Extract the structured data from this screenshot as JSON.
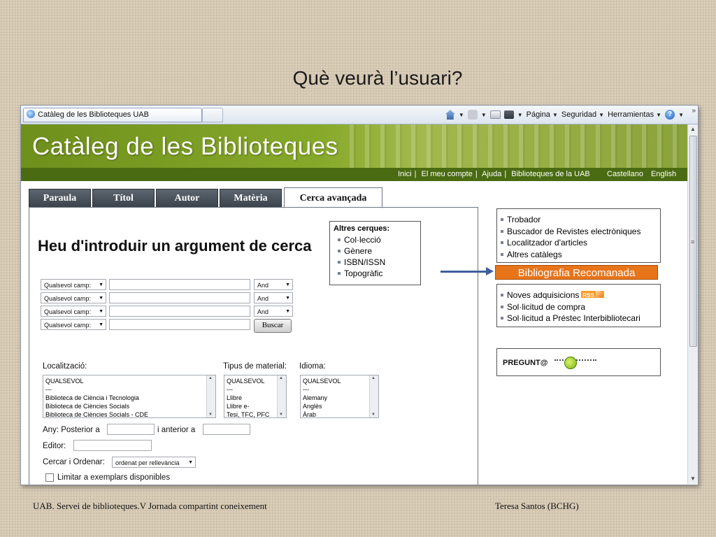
{
  "slide": {
    "title": "Què veurà l’usuari?",
    "footer_left": "UAB. Servei de biblioteques.V Jornada compartint coneixement",
    "footer_right": "Teresa Santos (BCHG)"
  },
  "browser": {
    "tab_title": "Catàleg de les Biblioteques UAB",
    "toolbar": {
      "page": "Página",
      "security": "Seguridad",
      "tools": "Herramientas"
    }
  },
  "site": {
    "title": "Catàleg de les Biblioteques",
    "nav": [
      "Inici",
      "El meu compte",
      "Ajuda",
      "Biblioteques de la UAB"
    ],
    "languages": [
      "Castellano",
      "English"
    ],
    "accent": "#87a92a"
  },
  "tabs": [
    "Paraula",
    "Títol",
    "Autor",
    "Matèria",
    "Cerca avançada"
  ],
  "active_tab": "Cerca avançada",
  "form": {
    "heading": "Heu d'introduir un argument de cerca",
    "rows": [
      {
        "field": "Qualsevol camp:",
        "operator": "And"
      },
      {
        "field": "Qualsevol camp:",
        "operator": "And"
      },
      {
        "field": "Qualsevol camp:",
        "operator": "And"
      },
      {
        "field": "Qualsevol camp:",
        "operator": ""
      }
    ],
    "search_button": "Buscar",
    "localitzacio": {
      "label": "Localització:",
      "options": [
        "QUALSEVOL",
        "---",
        "Biblioteca de Ciència i Tecnologia",
        "Biblioteca de Ciències Socials",
        "Biblioteca de Ciències Socials - CDE"
      ]
    },
    "tipus": {
      "label": "Tipus de material:",
      "options": [
        "QUALSEVOL",
        "---",
        "Llibre",
        "Llibre e-",
        "Tesi, TFC, PFC"
      ]
    },
    "idioma": {
      "label": "Idioma:",
      "options": [
        "QUALSEVOL",
        "---",
        "Alemany",
        "Anglès",
        "Àrab"
      ]
    },
    "any_label": "Any: Posterior a",
    "anterior_label": "i anterior a",
    "editor_label": "Editor:",
    "ordenar_label": "Cercar i Ordenar:",
    "ordenar_value": "ordenat per rellevància",
    "limitar_label": "Limitar a exemplars disponibles"
  },
  "altres_cerques": {
    "title": "Altres cerques:",
    "items": [
      "Col·lecció",
      "Gènere",
      "ISBN/ISSN",
      "Topogràfic"
    ]
  },
  "right_links": [
    "Trobador",
    "Buscador de Revistes electròniques",
    "Localitzador d'articles",
    "Altres catàlegs"
  ],
  "bibliografia": "Bibliografia Recomanada",
  "right_links2": {
    "noves": "Noves adquisicions",
    "rss": "RSS",
    "compra": "Sol·licitud de compra",
    "prestec": "Sol·licitud a Préstec Interbibliotecari"
  },
  "pregunta": "PREGUNT@"
}
